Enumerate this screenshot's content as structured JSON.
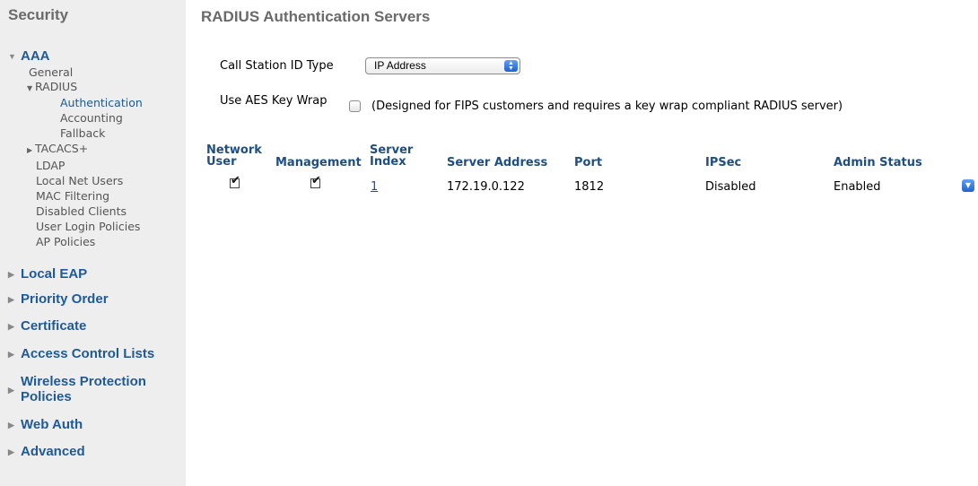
{
  "sidebar": {
    "title": "Security",
    "aaa": {
      "label": "AAA",
      "items": {
        "general": "General",
        "radius": "RADIUS",
        "radius_sub": [
          "Authentication",
          "Accounting",
          "Fallback"
        ],
        "tacacs": "TACACS+",
        "ldap": "LDAP",
        "local_net_users": "Local Net Users",
        "mac_filtering": "MAC Filtering",
        "disabled_clients": "Disabled Clients",
        "user_login_policies": "User Login Policies",
        "ap_policies": "AP Policies"
      }
    },
    "sections": {
      "local_eap": "Local EAP",
      "priority_order": "Priority Order",
      "certificate": "Certificate",
      "acl": "Access Control Lists",
      "wpp_line1": "Wireless Protection",
      "wpp_line2": "Policies",
      "web_auth": "Web Auth",
      "advanced": "Advanced"
    }
  },
  "main": {
    "title": "RADIUS Authentication Servers",
    "call_station_label": "Call Station ID Type",
    "call_station_value": "IP Address",
    "aes_label": "Use AES Key Wrap",
    "aes_checked": false,
    "aes_note": "(Designed for FIPS customers and requires a key wrap compliant RADIUS server)"
  },
  "table": {
    "headers": {
      "network_user_1": "Network",
      "network_user_2": "User",
      "management": "Management",
      "server_index_1": "Server",
      "server_index_2": "Index",
      "server_address": "Server Address",
      "port": "Port",
      "ipsec": "IPSec",
      "admin_status": "Admin Status"
    },
    "rows": [
      {
        "network_user": true,
        "management": true,
        "server_index": "1",
        "server_address": "172.19.0.122",
        "port": "1812",
        "ipsec": "Disabled",
        "admin_status": "Enabled"
      }
    ]
  },
  "icons": {
    "expanded": "triangle-down-icon",
    "collapsed": "triangle-right-icon",
    "select_arrows": "up-down-arrows-icon",
    "row_menu": "dropdown-arrow-icon"
  },
  "colors": {
    "sidebar_bg": "#eeeeee",
    "section_link": "#1f5a96",
    "header_text": "#1f4f82",
    "title_gray": "#6a6a6a",
    "accent_blue": "#1e62d0"
  }
}
